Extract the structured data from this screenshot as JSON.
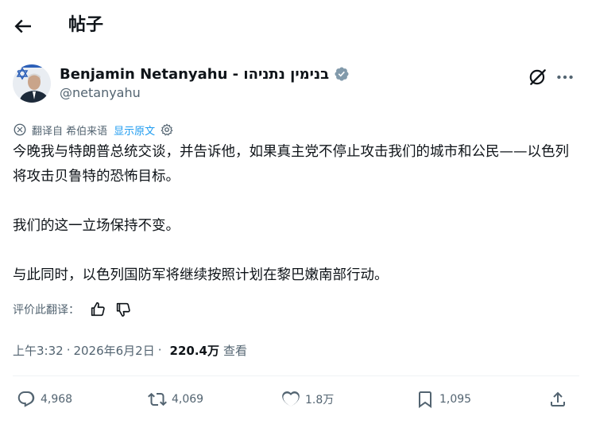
{
  "header": {
    "title": "帖子"
  },
  "post": {
    "author_name": "Benjamin Netanyahu - בנימין נתניהו",
    "handle": "@netanyahu",
    "translation": {
      "label": "翻译自 希伯来语",
      "show_original": "显示原文"
    },
    "body": {
      "paragraph_1": "今晚我与特朗普总统交谈，并告诉他，如果真主党不停止攻击我们的城市和公民——以色列将攻击贝鲁特的恐怖目标。",
      "paragraph_2": "我们的这一立场保持不变。",
      "paragraph_3": "与此同时，以色列国防军将继续按照计划在黎巴嫩南部行动。"
    },
    "rate_translation": "评价此翻译：",
    "time": "上午3:32",
    "date": "2026年6月2日",
    "views_count": "220.4万",
    "views_label": "查看"
  },
  "actions": {
    "replies": "4,968",
    "reposts": "4,069",
    "likes": "1.8万",
    "bookmarks": "1,095"
  },
  "colors": {
    "link": "#1d9bf0",
    "secondary_text": "#536471",
    "primary_text": "#0f1419"
  }
}
